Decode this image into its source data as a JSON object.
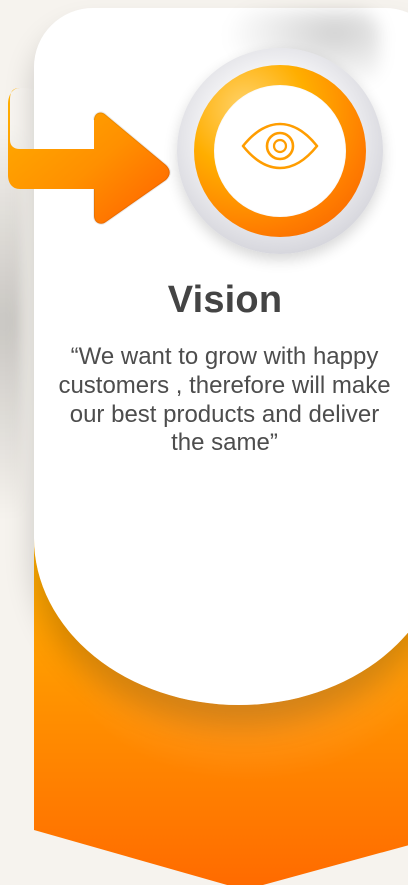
{
  "card": {
    "title": "Vision",
    "quote": "“We want to grow with happy customers , therefore will make our best products and deliver the same”"
  },
  "icons": {
    "arrow": "orange-arrow-icon",
    "eye": "eye-icon"
  },
  "colors": {
    "background": "#f6f3ee",
    "white": "#ffffff",
    "orange_light": "#ffc400",
    "orange_mid": "#ff9800",
    "orange_dark": "#ff6a00",
    "text_dark": "#444444",
    "text_body": "#4d4d4d",
    "ring_gray": "#d8d8de"
  }
}
